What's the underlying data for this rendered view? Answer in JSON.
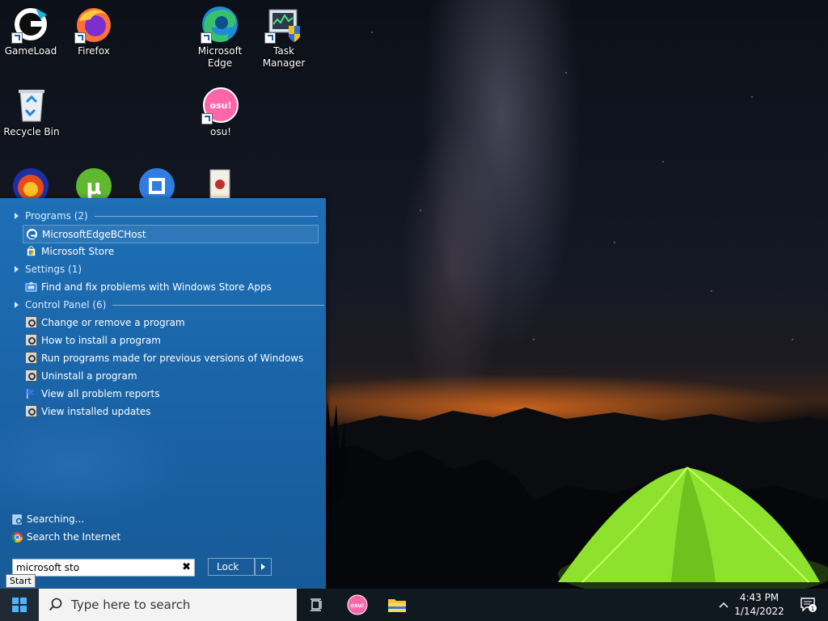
{
  "desktop": {
    "icons": [
      {
        "label": "GameLoad",
        "icon": "gameload-icon"
      },
      {
        "label": "Firefox",
        "icon": "firefox-icon"
      },
      {
        "label": "Microsoft Edge",
        "icon": "edge-icon"
      },
      {
        "label": "Task Manager",
        "icon": "task-manager-icon"
      },
      {
        "label": "Recycle Bin",
        "icon": "recycle-bin-icon"
      },
      {
        "label": "osu!",
        "icon": "osu-icon"
      }
    ],
    "osu_badge": "osu!"
  },
  "start_menu": {
    "groups": [
      {
        "title": "Programs (2)",
        "items": [
          {
            "label": "MicrosoftEdgeBCHost",
            "icon": "edge-small-icon",
            "selected": true
          },
          {
            "label": "Microsoft Store",
            "icon": "store-icon"
          }
        ]
      },
      {
        "title": "Settings (1)",
        "items": [
          {
            "label": "Find and fix problems with Windows Store Apps",
            "icon": "troubleshoot-icon"
          }
        ]
      },
      {
        "title": "Control Panel (6)",
        "items": [
          {
            "label": "Change or remove a program",
            "icon": "control-panel-icon"
          },
          {
            "label": "How to install a program",
            "icon": "control-panel-icon"
          },
          {
            "label": "Run programs made for previous versions of Windows",
            "icon": "control-panel-icon"
          },
          {
            "label": "Uninstall a program",
            "icon": "control-panel-icon"
          },
          {
            "label": "View all problem reports",
            "icon": "flag-icon"
          },
          {
            "label": "View installed updates",
            "icon": "control-panel-icon"
          }
        ]
      }
    ],
    "searching_label": "Searching...",
    "search_internet_label": "Search the Internet",
    "search_value": "microsoft sto",
    "lock_label": "Lock",
    "start_tooltip": "Start"
  },
  "taskbar": {
    "search_placeholder": "Type here to search",
    "osu_badge": "osu!",
    "time": "4:43 PM",
    "date": "1/14/2022",
    "notification_count": "1"
  },
  "colors": {
    "start_menu_bg": "#1a63a6",
    "taskbar_bg": "#101820",
    "accent": "#1a5fb4"
  }
}
